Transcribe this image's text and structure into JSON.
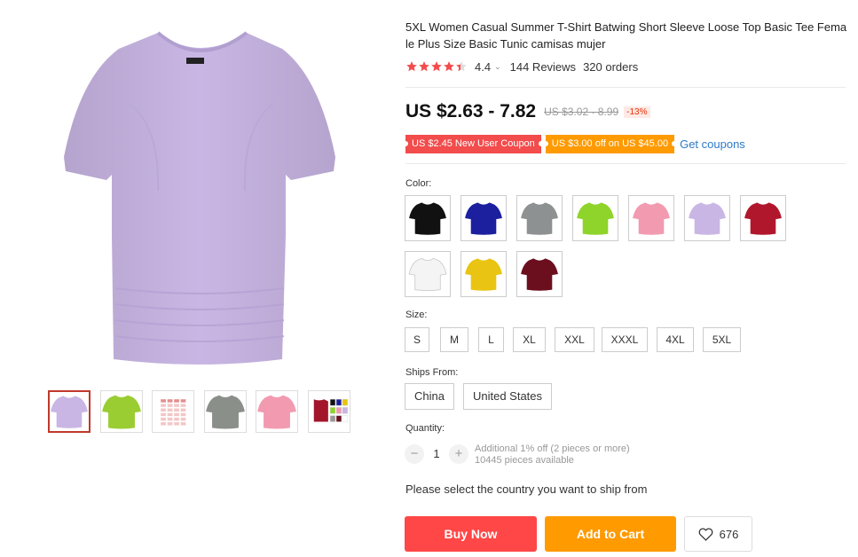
{
  "product": {
    "title": "5XL Women Casual Summer T-Shirt Batwing Short Sleeve Loose Top Basic Tee Female Plus Size Basic Tunic camisas mujer",
    "rating": "4.4",
    "rating_stars": 4.4,
    "reviews": "144 Reviews",
    "orders": "320 orders",
    "price": "US $2.63 - 7.82",
    "old_price": "US $3.02 - 8.99",
    "discount": "-13%",
    "main_color": "#c9b6e4"
  },
  "coupons": {
    "new_user": "US $2.45 New User Coupon",
    "store": "US $3.00 off on US $45.00",
    "get_coupons": "Get coupons"
  },
  "gallery": {
    "thumbs": [
      {
        "name": "thumb-lavender",
        "color": "#c9b6e4"
      },
      {
        "name": "thumb-lime",
        "color": "#9acd32"
      },
      {
        "name": "thumb-size-chart",
        "color": "#f3c6c6"
      },
      {
        "name": "thumb-gray",
        "color": "#8a8f8a"
      },
      {
        "name": "thumb-pink",
        "color": "#f29bb0"
      },
      {
        "name": "thumb-multicolor",
        "color": "#a3152b"
      }
    ]
  },
  "color": {
    "label": "Color:",
    "swatches": [
      {
        "name": "black",
        "color": "#111111"
      },
      {
        "name": "navy",
        "color": "#1c1f9e"
      },
      {
        "name": "gray",
        "color": "#8e9191"
      },
      {
        "name": "lime",
        "color": "#8fd42a"
      },
      {
        "name": "pink",
        "color": "#f29bb0"
      },
      {
        "name": "lavender",
        "color": "#c9b6e4"
      },
      {
        "name": "red",
        "color": "#b1172c"
      },
      {
        "name": "white",
        "color": "#f4f4f4"
      },
      {
        "name": "yellow",
        "color": "#e9c412"
      },
      {
        "name": "wine",
        "color": "#6b0f1f"
      }
    ]
  },
  "size": {
    "label": "Size:",
    "options": [
      "S",
      "M",
      "L",
      "XL",
      "XXL",
      "XXXL",
      "4XL",
      "5XL"
    ]
  },
  "ships_from": {
    "label": "Ships From:",
    "options": [
      "China",
      "United States"
    ]
  },
  "quantity": {
    "label": "Quantity:",
    "value": "1",
    "minus": "−",
    "plus": "+",
    "note": "Additional 1% off (2 pieces or more)",
    "available": "10445 pieces available"
  },
  "shipping_message": "Please select the country you want to ship from",
  "actions": {
    "buy_now": "Buy Now",
    "add_to_cart": "Add to Cart",
    "wishlist_count": "676"
  }
}
